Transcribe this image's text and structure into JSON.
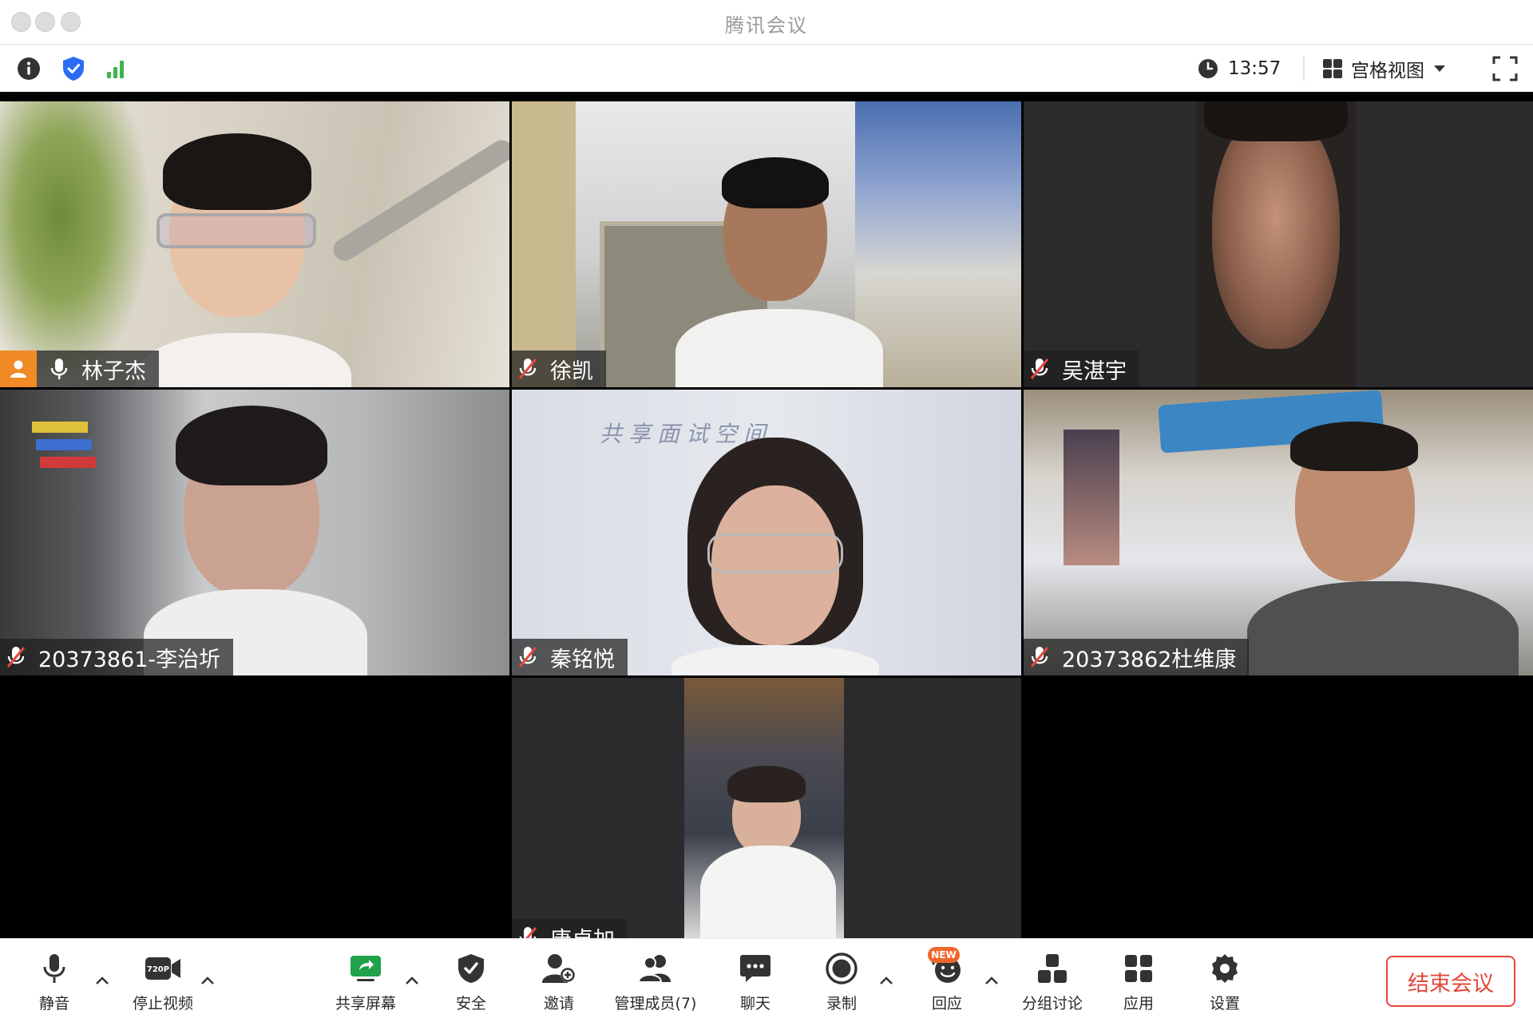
{
  "window": {
    "title": "腾讯会议"
  },
  "infobar": {
    "time": "13:57",
    "view_mode": "宫格视图"
  },
  "participants": [
    {
      "name": "林子杰",
      "mic": "on",
      "host": true
    },
    {
      "name": "徐凯",
      "mic": "muted",
      "host": false
    },
    {
      "name": "吴湛宇",
      "mic": "muted",
      "host": false
    },
    {
      "name": "20373861-李治圻",
      "mic": "muted",
      "host": false
    },
    {
      "name": "秦铭悦",
      "mic": "muted",
      "host": false
    },
    {
      "name": "20373862杜维康",
      "mic": "muted",
      "host": false
    },
    {
      "name": "唐卓加",
      "mic": "muted",
      "host": false
    }
  ],
  "whiteboard_text": "共享面试空间",
  "toolbar": {
    "mute": "静音",
    "stop_video": "停止视频",
    "video_quality": "720P",
    "share_screen": "共享屏幕",
    "security": "安全",
    "invite": "邀请",
    "manage_members": "管理成员(7)",
    "chat": "聊天",
    "record": "录制",
    "reactions": "回应",
    "reactions_badge": "NEW",
    "breakout": "分组讨论",
    "apps": "应用",
    "settings": "设置",
    "end_meeting": "结束会议"
  },
  "colors": {
    "end_button": "#e5473b",
    "host_badge": "#f08a24",
    "signal": "#3fb34f",
    "shield": "#2a6df4",
    "share_icon": "#1fa24a"
  }
}
